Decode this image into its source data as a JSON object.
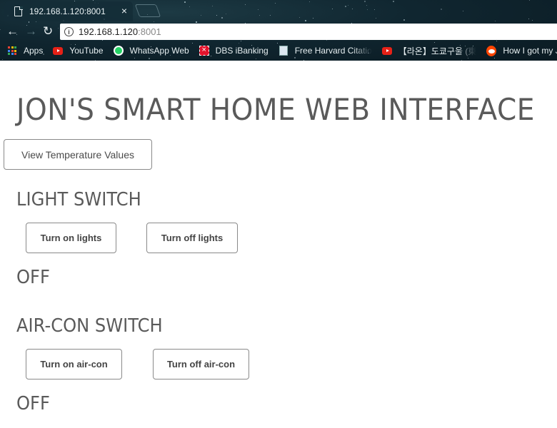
{
  "browser": {
    "tab": {
      "title": "192.168.1.120:8001",
      "close_glyph": "×"
    },
    "nav": {
      "back_glyph": "←",
      "forward_glyph": "→",
      "reload_glyph": "↻"
    },
    "address": {
      "host": "192.168.1.120",
      "port": ":8001",
      "info_glyph": "i"
    },
    "bookmarks": [
      {
        "label": "Apps",
        "icon": "apps-grid-icon"
      },
      {
        "label": "YouTube",
        "icon": "youtube-icon"
      },
      {
        "label": "WhatsApp Web",
        "icon": "whatsapp-icon"
      },
      {
        "label": "DBS iBanking",
        "icon": "dbs-icon"
      },
      {
        "label": "Free Harvard Citatio",
        "icon": "book-icon"
      },
      {
        "label": "【라온】도쿄구울 (東",
        "icon": "youtube-icon"
      },
      {
        "label": "How I got my Jinha",
        "icon": "reddit-icon"
      }
    ]
  },
  "page": {
    "title": "JON'S SMART HOME WEB INTERFACE",
    "temperature_button": "View Temperature Values",
    "light": {
      "heading": "LIGHT SWITCH",
      "on_button": "Turn on lights",
      "off_button": "Turn off lights",
      "status": "OFF"
    },
    "aircon": {
      "heading": "AIR-CON SWITCH",
      "on_button": "Turn on air-con",
      "off_button": "Turn off air-con",
      "status": "OFF"
    }
  }
}
